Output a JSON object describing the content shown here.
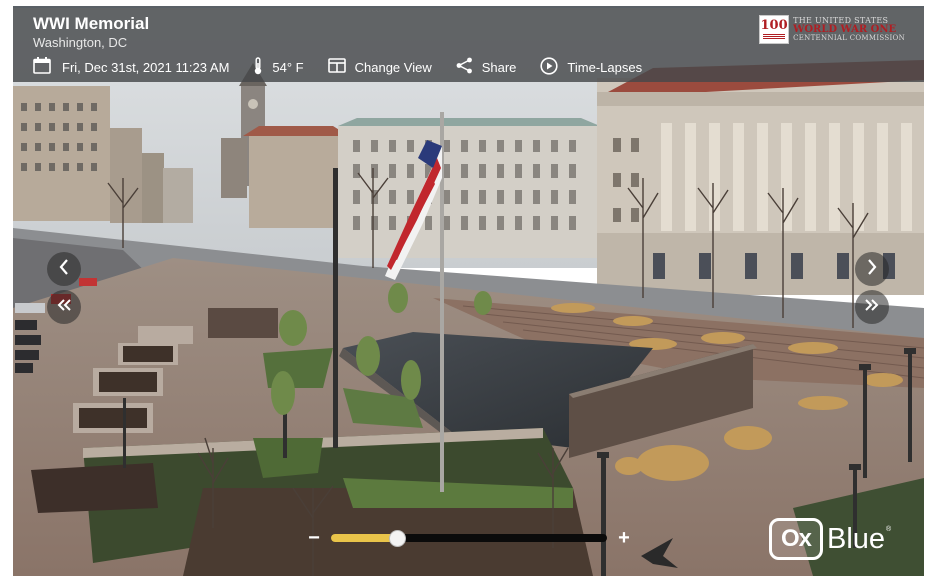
{
  "header": {
    "title": "WWI Memorial",
    "location": "Washington, DC"
  },
  "toolbar": {
    "datetime": "Fri, Dec 31st, 2021 11:23 AM",
    "temperature": "54° F",
    "change_view_label": "Change View",
    "share_label": "Share",
    "timelapses_label": "Time-Lapses"
  },
  "logo": {
    "number": "100",
    "line1": "THE UNITED STATES",
    "line2": "WORLD WAR ONE",
    "line3": "CENTENNIAL COMMISSION"
  },
  "zoom": {
    "minus_label": "−",
    "plus_label": "+",
    "level": 0.24
  },
  "watermark": {
    "box_text": "Ox",
    "word": "Blue",
    "tm": "®"
  },
  "icons": {
    "date": "calendar-icon",
    "temperature": "thermometer-icon",
    "change_view": "split-view-icon",
    "share": "share-icon",
    "timelapses": "play-circle-icon",
    "nav": [
      "chevron-left-icon",
      "chevron-right-icon",
      "double-chevron-left-icon",
      "double-chevron-right-icon"
    ]
  },
  "colors": {
    "topbar": "#46484b",
    "zoom_fill": "#e9c44a",
    "logo_red": "#b01e23"
  }
}
